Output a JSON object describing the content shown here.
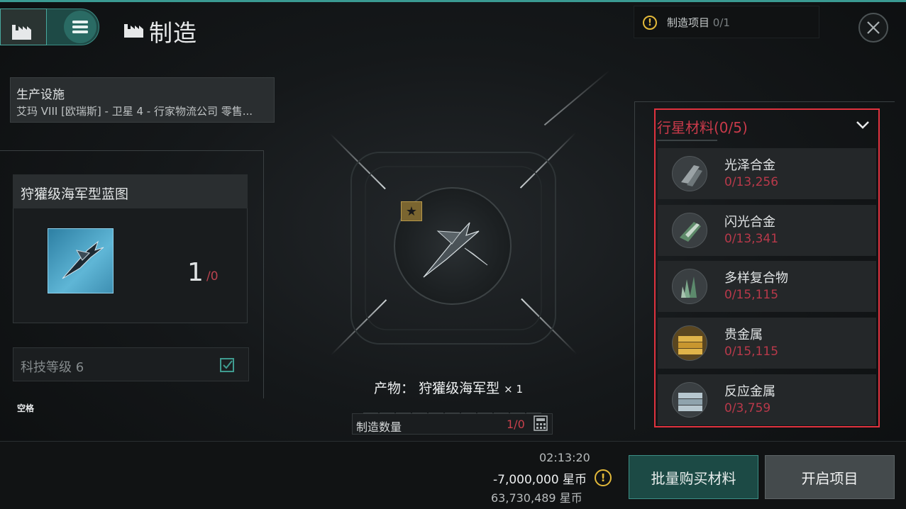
{
  "header": {
    "title": "制造",
    "project_label": "制造项目",
    "project_count": "0/1"
  },
  "facility": {
    "title": "生产设施",
    "location": "艾玛 VIII [欧瑞斯] - 卫星 4 - 行家物流公司 零售..."
  },
  "blueprint": {
    "name": "狩獾级海军型蓝图",
    "count": "1",
    "count_sub": "/0",
    "tech_level": "科技等级 6"
  },
  "hotkey": "空格",
  "product": {
    "label": "产物：",
    "name": "狩獾级海军型",
    "multiplier": "× 1"
  },
  "quantity": {
    "label": "制造数量",
    "value": "1/0"
  },
  "materials": {
    "title": "行星材料",
    "count": "(0/5)",
    "items": [
      {
        "name": "光泽合金",
        "amount": "0/13,256",
        "icon": "lustering-alloy-icon"
      },
      {
        "name": "闪光合金",
        "amount": "0/13,341",
        "icon": "sheen-compound-icon"
      },
      {
        "name": "多样复合物",
        "amount": "0/15,115",
        "icon": "diverse-compound-icon"
      },
      {
        "name": "贵金属",
        "amount": "0/15,115",
        "icon": "precious-metal-icon"
      },
      {
        "name": "反应金属",
        "amount": "0/3,759",
        "icon": "reactive-metal-icon"
      }
    ]
  },
  "footer": {
    "time": "02:13:20",
    "cost": "-7,000,000 星币",
    "balance": "63,730,489 星币",
    "buy_label": "批量购买材料",
    "start_label": "开启项目"
  },
  "colors": {
    "accent": "#3a9a92",
    "warning": "#e3b93a",
    "deficit": "#c93a4a",
    "highlight_box": "#e0323e"
  }
}
